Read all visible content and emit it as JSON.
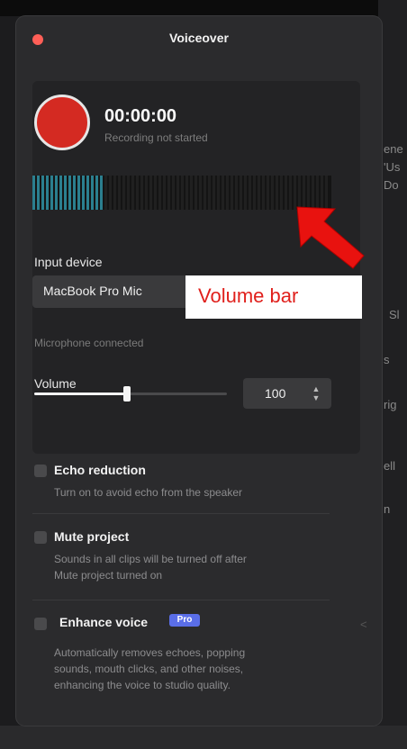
{
  "background": {
    "right_fragments": [
      "ene",
      "'Us",
      "Do",
      "Sl",
      "s",
      "rig",
      "ell",
      "n",
      "<"
    ]
  },
  "window": {
    "title": "Voiceover"
  },
  "recorder": {
    "timer": "00:00:00",
    "status": "Recording not started",
    "level_fraction": 0.24
  },
  "input_device": {
    "label": "Input device",
    "selected": "MacBook Pro Mic",
    "status": "Microphone connected"
  },
  "volume": {
    "label": "Volume",
    "value": "100",
    "slider_fraction": 0.48
  },
  "options": [
    {
      "title": "Echo reduction",
      "desc1": "Turn on to avoid echo from the speaker",
      "desc2": "",
      "desc3": ""
    },
    {
      "title": "Mute project",
      "desc1": "Sounds in all clips will be turned off after",
      "desc2": "Mute project turned on",
      "desc3": ""
    },
    {
      "title": "Enhance voice",
      "badge": "Pro",
      "desc1": "Automatically removes echoes, popping",
      "desc2": "sounds, mouth clicks, and other noises,",
      "desc3": "enhancing the voice to studio quality."
    }
  ],
  "annotation": {
    "label": "Volume bar"
  },
  "colors": {
    "record": "#d42a22",
    "meter_active": "#2b7f8f",
    "annotation_red": "#e0201c",
    "pro_badge": "#5a6ee8"
  }
}
